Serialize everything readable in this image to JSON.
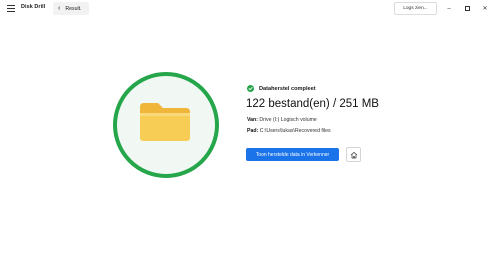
{
  "app": {
    "name": "Disk Drill",
    "back_label": "Result."
  },
  "titlebar": {
    "logs_label": "Logs zien...",
    "icons": [
      "menu-icon",
      "back-chevron-icon",
      "minimize-icon",
      "maximize-icon",
      "close-icon"
    ]
  },
  "result": {
    "status": "Dataherstel compleet",
    "summary": "122 bestand(en) / 251 MB",
    "from_label": "Van:",
    "from_value": "Drive (I:) Logisch volume",
    "path_label": "Pad:",
    "path_value": "C:\\Users\\lukas\\Recovered files",
    "show_button": "Toon herstelde data in Verkenner",
    "icons": [
      "folder-icon",
      "check-circle-icon",
      "home-icon"
    ]
  },
  "colors": {
    "accent": "#1a73e8",
    "success": "#25a64a",
    "circle_fill": "#f1f8f3",
    "folder": "#f7cd55"
  }
}
